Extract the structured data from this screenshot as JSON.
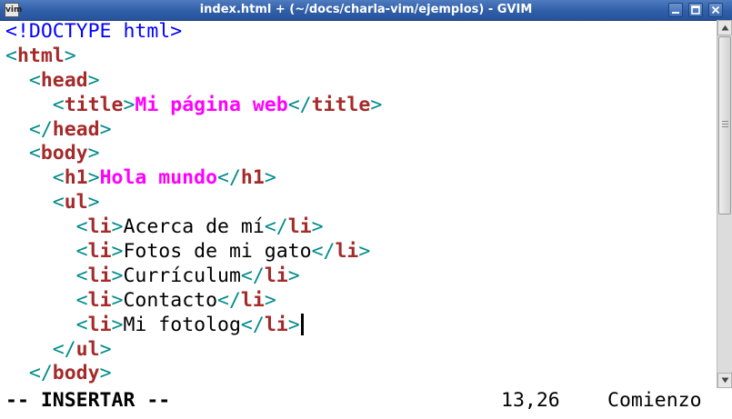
{
  "window": {
    "title": "index.html + (~/docs/charla-vim/ejemplos) - GVIM",
    "icon_label": "vim"
  },
  "buffer": [
    {
      "tokens": [
        {
          "text": "<!DOCTYPE html>",
          "kind": "doctype"
        }
      ]
    },
    {
      "tokens": [
        {
          "text": "<",
          "kind": "bracket"
        },
        {
          "text": "html",
          "kind": "tag"
        },
        {
          "text": ">",
          "kind": "bracket"
        }
      ]
    },
    {
      "tokens": [
        {
          "text": "  ",
          "kind": "text"
        },
        {
          "text": "<",
          "kind": "bracket"
        },
        {
          "text": "head",
          "kind": "tag"
        },
        {
          "text": ">",
          "kind": "bracket"
        }
      ]
    },
    {
      "tokens": [
        {
          "text": "    ",
          "kind": "text"
        },
        {
          "text": "<",
          "kind": "bracket"
        },
        {
          "text": "title",
          "kind": "tag"
        },
        {
          "text": ">",
          "kind": "bracket"
        },
        {
          "text": "Mi página web",
          "kind": "title"
        },
        {
          "text": "</",
          "kind": "bracket"
        },
        {
          "text": "title",
          "kind": "tag"
        },
        {
          "text": ">",
          "kind": "bracket"
        }
      ]
    },
    {
      "tokens": [
        {
          "text": "  ",
          "kind": "text"
        },
        {
          "text": "</",
          "kind": "bracket"
        },
        {
          "text": "head",
          "kind": "tag"
        },
        {
          "text": ">",
          "kind": "bracket"
        }
      ]
    },
    {
      "tokens": [
        {
          "text": "  ",
          "kind": "text"
        },
        {
          "text": "<",
          "kind": "bracket"
        },
        {
          "text": "body",
          "kind": "tag"
        },
        {
          "text": ">",
          "kind": "bracket"
        }
      ]
    },
    {
      "tokens": [
        {
          "text": "    ",
          "kind": "text"
        },
        {
          "text": "<",
          "kind": "bracket"
        },
        {
          "text": "h1",
          "kind": "tag"
        },
        {
          "text": ">",
          "kind": "bracket"
        },
        {
          "text": "Hola mundo",
          "kind": "title"
        },
        {
          "text": "</",
          "kind": "bracket"
        },
        {
          "text": "h1",
          "kind": "tag"
        },
        {
          "text": ">",
          "kind": "bracket"
        }
      ]
    },
    {
      "tokens": [
        {
          "text": "    ",
          "kind": "text"
        },
        {
          "text": "<",
          "kind": "bracket"
        },
        {
          "text": "ul",
          "kind": "tag"
        },
        {
          "text": ">",
          "kind": "bracket"
        }
      ]
    },
    {
      "tokens": [
        {
          "text": "      ",
          "kind": "text"
        },
        {
          "text": "<",
          "kind": "bracket"
        },
        {
          "text": "li",
          "kind": "tag"
        },
        {
          "text": ">",
          "kind": "bracket"
        },
        {
          "text": "Acerca de mí",
          "kind": "text"
        },
        {
          "text": "</",
          "kind": "bracket"
        },
        {
          "text": "li",
          "kind": "tag"
        },
        {
          "text": ">",
          "kind": "bracket"
        }
      ]
    },
    {
      "tokens": [
        {
          "text": "      ",
          "kind": "text"
        },
        {
          "text": "<",
          "kind": "bracket"
        },
        {
          "text": "li",
          "kind": "tag"
        },
        {
          "text": ">",
          "kind": "bracket"
        },
        {
          "text": "Fotos de mi gato",
          "kind": "text"
        },
        {
          "text": "</",
          "kind": "bracket"
        },
        {
          "text": "li",
          "kind": "tag"
        },
        {
          "text": ">",
          "kind": "bracket"
        }
      ]
    },
    {
      "tokens": [
        {
          "text": "      ",
          "kind": "text"
        },
        {
          "text": "<",
          "kind": "bracket"
        },
        {
          "text": "li",
          "kind": "tag"
        },
        {
          "text": ">",
          "kind": "bracket"
        },
        {
          "text": "Currículum",
          "kind": "text"
        },
        {
          "text": "</",
          "kind": "bracket"
        },
        {
          "text": "li",
          "kind": "tag"
        },
        {
          "text": ">",
          "kind": "bracket"
        }
      ]
    },
    {
      "tokens": [
        {
          "text": "      ",
          "kind": "text"
        },
        {
          "text": "<",
          "kind": "bracket"
        },
        {
          "text": "li",
          "kind": "tag"
        },
        {
          "text": ">",
          "kind": "bracket"
        },
        {
          "text": "Contacto",
          "kind": "text"
        },
        {
          "text": "</",
          "kind": "bracket"
        },
        {
          "text": "li",
          "kind": "tag"
        },
        {
          "text": ">",
          "kind": "bracket"
        }
      ]
    },
    {
      "tokens": [
        {
          "text": "      ",
          "kind": "text"
        },
        {
          "text": "<",
          "kind": "bracket"
        },
        {
          "text": "li",
          "kind": "tag"
        },
        {
          "text": ">",
          "kind": "bracket"
        },
        {
          "text": "Mi fotolog",
          "kind": "text"
        },
        {
          "text": "</",
          "kind": "bracket"
        },
        {
          "text": "li",
          "kind": "tag"
        },
        {
          "text": ">",
          "kind": "bracket"
        }
      ],
      "cursor": true
    },
    {
      "tokens": [
        {
          "text": "    ",
          "kind": "text"
        },
        {
          "text": "</",
          "kind": "bracket"
        },
        {
          "text": "ul",
          "kind": "tag"
        },
        {
          "text": ">",
          "kind": "bracket"
        }
      ]
    },
    {
      "tokens": [
        {
          "text": "  ",
          "kind": "text"
        },
        {
          "text": "</",
          "kind": "bracket"
        },
        {
          "text": "body",
          "kind": "tag"
        },
        {
          "text": ">",
          "kind": "bracket"
        }
      ]
    }
  ],
  "statusline": {
    "mode": "-- INSERTAR --",
    "position": "13,26",
    "scroll": "Comienzo"
  },
  "colors": {
    "titlebar": "#2f5ea8",
    "bracket": "#008b8b",
    "tag": "#a52a2a",
    "title_text": "#ff00ff",
    "doctype": "#0000ff",
    "text": "#000000"
  },
  "icons": {
    "app": "vim-icon",
    "minimize": "minimize-icon",
    "maximize": "maximize-icon",
    "close": "close-icon",
    "scroll_up": "arrow-up-icon",
    "scroll_down": "arrow-down-icon"
  }
}
